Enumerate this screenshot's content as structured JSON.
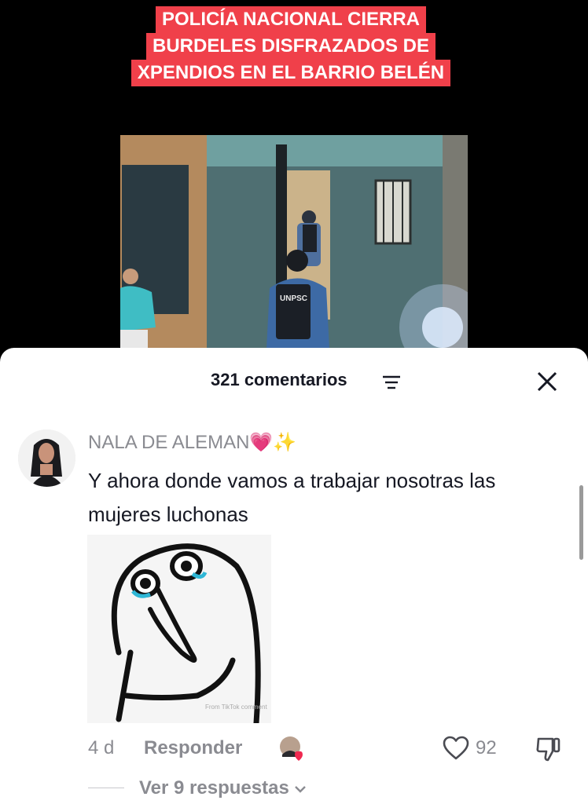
{
  "video": {
    "headline_lines": [
      "POLICÍA NACIONAL CIERRA",
      "BURDELES DISFRAZADOS DE",
      "XPENDIOS EN EL BARRIO BELÉN"
    ],
    "thumbnail_text": "UNPSC"
  },
  "comments_sheet": {
    "count_label": "321 comentarios",
    "comment": {
      "author": "NALA DE ALEMAN💗✨",
      "text": "Y ahora donde vamos a trabajar nosotras las mujeres luchonas",
      "time": "4 d",
      "reply_label": "Responder",
      "likes": "92",
      "view_replies": "Ver 9 respuestas",
      "sticker_watermark": "From TikTok comment"
    }
  },
  "colors": {
    "headline_bg": "#f0404a",
    "muted_text": "#8a8b91",
    "primary_text": "#161823",
    "liked_heart": "#ef2950"
  },
  "icons": {
    "sort": "sort-lines-icon",
    "close": "close-x-icon",
    "like": "heart-outline-icon",
    "dislike": "thumb-down-icon",
    "expand": "chevron-down-icon"
  }
}
